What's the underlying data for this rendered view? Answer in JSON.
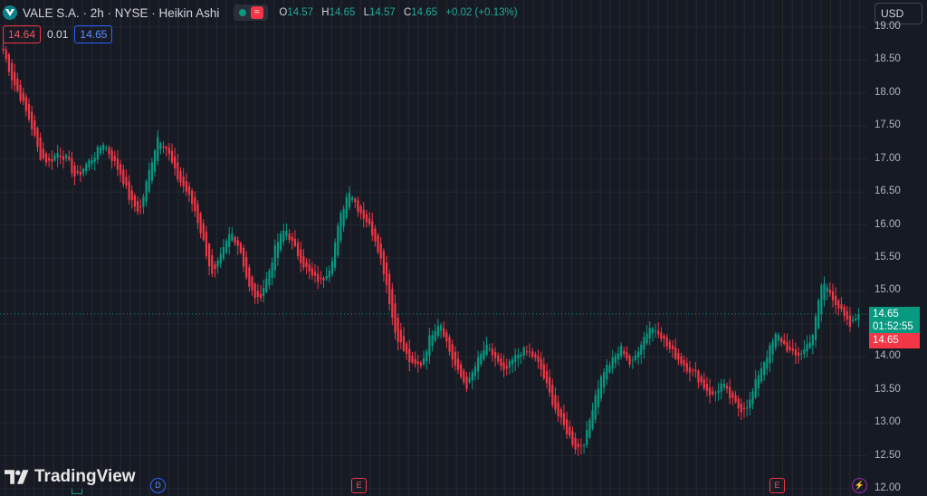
{
  "header": {
    "symbol_title": "VALE S.A. · 2h · NYSE · Heikin Ashi",
    "ohlc": [
      {
        "key": "O",
        "value": "14.57"
      },
      {
        "key": "H",
        "value": "14.65"
      },
      {
        "key": "L",
        "value": "14.57"
      },
      {
        "key": "C",
        "value": "14.65"
      }
    ],
    "change": "+0.02 (+0.13%)"
  },
  "quote": {
    "bid": "14.64",
    "spread": "0.01",
    "ask": "14.65"
  },
  "currency": "USD",
  "price_axis": {
    "labels": [
      "19.00",
      "18.50",
      "18.00",
      "17.50",
      "17.00",
      "16.50",
      "16.00",
      "15.50",
      "15.00",
      "14.50",
      "14.00",
      "13.50",
      "13.00",
      "12.50",
      "12.00"
    ]
  },
  "last_price": {
    "price": "14.65",
    "countdown": "01:52:55",
    "prev_price": "14.65"
  },
  "watermark": "TradingView",
  "events": [
    {
      "kind": "dividend",
      "label": "D"
    },
    {
      "kind": "earnings",
      "label": "E"
    },
    {
      "kind": "earnings",
      "label": "E"
    },
    {
      "kind": "flash",
      "label": "⚡"
    }
  ],
  "colors": {
    "up": "#089981",
    "down": "#f23645",
    "background": "#161a25",
    "accent": "#2962ff"
  },
  "chart_data": {
    "type": "candlestick",
    "chart_style": "Heikin Ashi",
    "interval": "2h",
    "symbol": "VALE",
    "exchange": "NYSE",
    "ylim": [
      12.0,
      19.0
    ],
    "grid": true,
    "last_close": 14.65,
    "keypoints_close": [
      18.65,
      18.2,
      17.9,
      17.55,
      17.05,
      16.95,
      17.1,
      17.0,
      16.7,
      16.9,
      17.05,
      17.25,
      17.0,
      16.75,
      16.35,
      16.2,
      16.8,
      17.35,
      17.15,
      16.75,
      16.55,
      16.25,
      15.75,
      15.2,
      15.55,
      15.9,
      15.65,
      15.05,
      14.85,
      15.2,
      15.7,
      15.95,
      15.65,
      15.4,
      15.2,
      15.15,
      15.4,
      16.1,
      16.55,
      16.25,
      16.05,
      15.75,
      15.2,
      14.4,
      14.1,
      13.85,
      13.9,
      14.35,
      14.55,
      14.1,
      13.75,
      13.55,
      13.9,
      14.15,
      14.0,
      13.75,
      13.95,
      14.1,
      14.05,
      13.85,
      13.45,
      13.1,
      12.85,
      12.6,
      12.75,
      13.4,
      13.8,
      13.95,
      14.15,
      13.85,
      14.2,
      14.45,
      14.4,
      14.15,
      14.0,
      13.85,
      13.75,
      13.55,
      13.4,
      13.6,
      13.35,
      13.2,
      13.3,
      13.75,
      14.05,
      14.35,
      14.15,
      14.0,
      14.1,
      14.35,
      15.15,
      14.95,
      14.7,
      14.45,
      14.65
    ]
  }
}
